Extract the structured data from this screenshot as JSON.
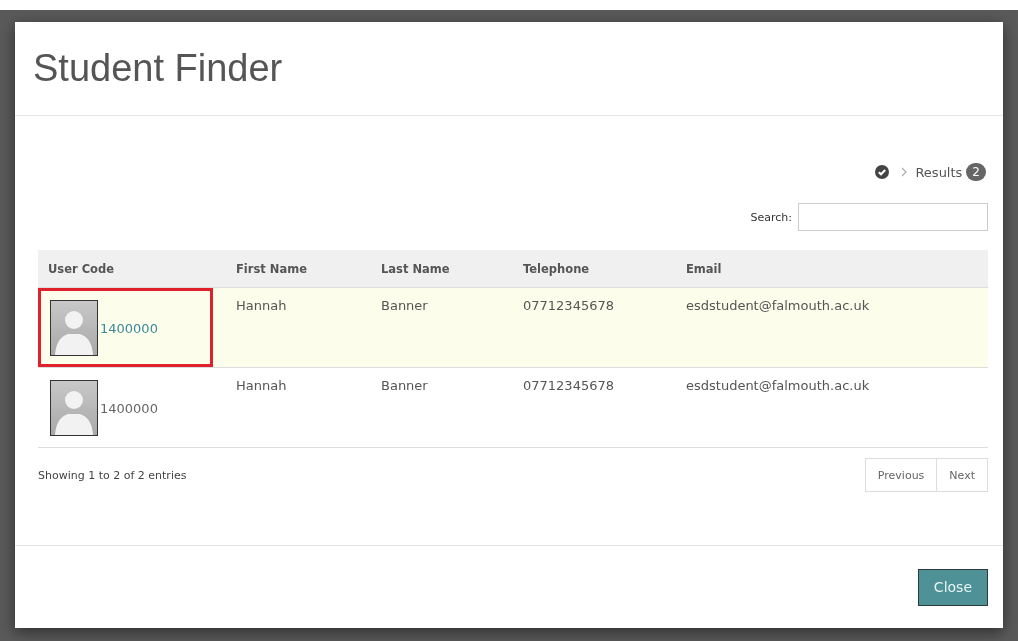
{
  "dialog": {
    "title": "Student Finder"
  },
  "breadcrumb": {
    "label": "Results",
    "count": "2"
  },
  "search": {
    "label": "Search:"
  },
  "table": {
    "columns": [
      "User Code",
      "First Name",
      "Last Name",
      "Telephone",
      "Email"
    ],
    "rows": [
      {
        "user_code": "1400000",
        "first_name": "Hannah",
        "last_name": "Banner",
        "telephone": "07712345678",
        "email": "esdstudent@falmouth.ac.uk",
        "selected": true,
        "marked": true
      },
      {
        "user_code": "1400000",
        "first_name": "Hannah",
        "last_name": "Banner",
        "telephone": "07712345678",
        "email": "esdstudent@falmouth.ac.uk",
        "selected": false,
        "marked": false
      }
    ]
  },
  "info": "Showing 1 to 2 of 2 entries",
  "pagination": [
    "Previous",
    "Next"
  ],
  "buttons": [
    "Close"
  ]
}
